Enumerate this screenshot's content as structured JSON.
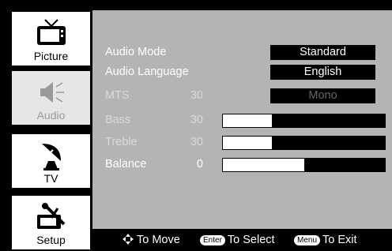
{
  "sidebar": {
    "items": [
      {
        "label": "Picture",
        "icon": "tv-icon"
      },
      {
        "label": "Audio",
        "icon": "speaker-icon"
      },
      {
        "label": "TV",
        "icon": "satellite-dish-icon"
      },
      {
        "label": "Setup",
        "icon": "wrench-screwdriver-icon"
      }
    ]
  },
  "audio_menu": {
    "audio_mode": {
      "label": "Audio Mode",
      "value": "Standard"
    },
    "audio_language": {
      "label": "Audio Language",
      "value": "English"
    },
    "mts": {
      "label": "MTS",
      "number": "30",
      "value": "Mono"
    },
    "bass": {
      "label": "Bass",
      "value": "30",
      "level_fraction": 0.3
    },
    "treble": {
      "label": "Treble",
      "value": "30",
      "level_fraction": 0.3
    },
    "balance": {
      "label": "Balance",
      "value": "0",
      "level_fraction": 0.5
    }
  },
  "footer": {
    "move_text": "To Move",
    "enter_key": "Enter",
    "select_text": "To Select",
    "menu_key": "Menu",
    "exit_text": "To Exit"
  }
}
